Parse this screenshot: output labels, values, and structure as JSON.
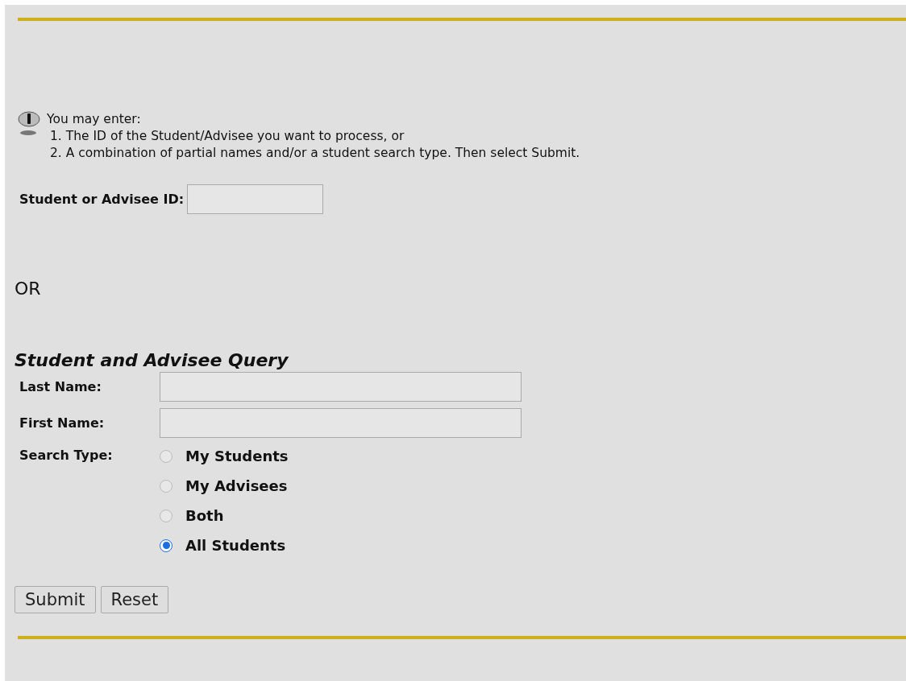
{
  "intro": {
    "heading": "You may enter:",
    "lines": [
      "1. The ID of the Student/Advisee you want to process, or",
      "2. A combination of partial names and/or a student search type. Then select Submit."
    ]
  },
  "id_field": {
    "label": "Student or Advisee ID:"
  },
  "separator": "OR",
  "query": {
    "title": "Student and Advisee Query",
    "fields": [
      {
        "label": "Last Name:"
      },
      {
        "label": "First Name:"
      }
    ],
    "search_type": {
      "label": "Search Type:",
      "options": [
        {
          "label": "My Students",
          "selected": false
        },
        {
          "label": "My Advisees",
          "selected": false
        },
        {
          "label": "Both",
          "selected": false
        },
        {
          "label": "All Students",
          "selected": true
        }
      ]
    }
  },
  "buttons": [
    "Submit",
    "Reset"
  ]
}
